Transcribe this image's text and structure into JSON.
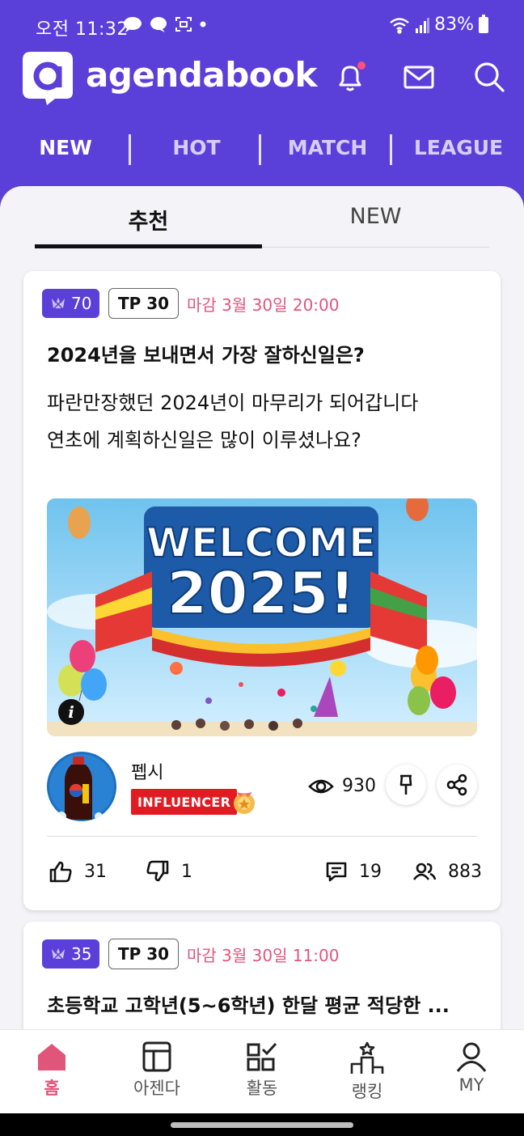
{
  "status": {
    "time": "오전 11:32",
    "battery": "83%"
  },
  "app": {
    "name": "agendabook"
  },
  "colors": {
    "brand": "#5b3fd9",
    "accent": "#e0557a",
    "badge": "#e21b23"
  },
  "main_tabs": [
    {
      "label": "NEW",
      "active": true
    },
    {
      "label": "HOT",
      "active": false
    },
    {
      "label": "MATCH",
      "active": false
    },
    {
      "label": "LEAGUE",
      "active": false
    }
  ],
  "sub_tabs": [
    {
      "label": "추천",
      "active": true
    },
    {
      "label": "NEW",
      "active": false
    }
  ],
  "posts": [
    {
      "points": "70",
      "tp": "TP 30",
      "deadline": "마감 3월 30일 20:00",
      "title": "2024년을 보내면서 가장 잘하신일은?",
      "body_lines": [
        "파란만장했던 2024년이 마무리가 되어갑니다",
        "연초에 계획하신일은 많이 이루셨나요?"
      ],
      "banner": {
        "line1": "WELCOME",
        "line2": "2025!",
        "info": "i"
      },
      "author": {
        "name": "펩시",
        "badge": "INFLUENCER"
      },
      "views": "930",
      "likes": "31",
      "dislikes": "1",
      "comments": "19",
      "participants": "883"
    },
    {
      "points": "35",
      "tp": "TP 30",
      "deadline": "마감 3월 30일 11:00",
      "title": "초등학교 고학년(5~6학년) 한달 평균 적당한 ..."
    }
  ],
  "bottom_nav": [
    {
      "label": "홈",
      "icon": "home-icon",
      "active": true
    },
    {
      "label": "아젠다",
      "icon": "agenda-icon",
      "active": false
    },
    {
      "label": "활동",
      "icon": "activity-icon",
      "active": false
    },
    {
      "label": "랭킹",
      "icon": "ranking-icon",
      "active": false
    },
    {
      "label": "MY",
      "icon": "profile-icon",
      "active": false
    }
  ]
}
